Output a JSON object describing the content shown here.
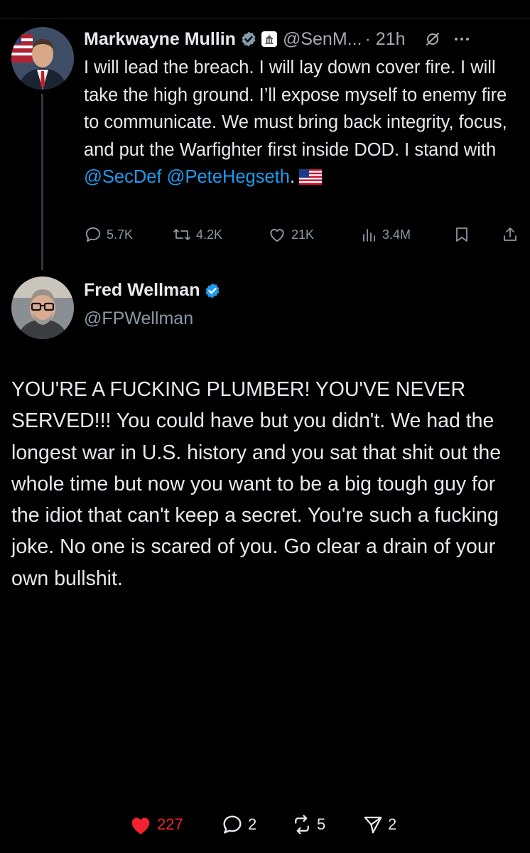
{
  "tweet1": {
    "author_name": "Markwayne Mullin",
    "handle": "@SenM...",
    "time": "· 21h",
    "body": {
      "text": "I will lead the breach. I will lay down cover fire. I will take the high ground. I’ll expose myself to enemy fire to communicate. We must bring back integrity, focus, and put the Warfighter first inside DOD. I stand with ",
      "mention1": "@SecDef",
      "mention2": "@PeteHegseth",
      "end": "."
    },
    "stats": {
      "replies": "5.7K",
      "reposts": "4.2K",
      "likes": "21K",
      "views": "3.4M"
    }
  },
  "tweet2": {
    "author_name": "Fred Wellman",
    "handle": "@FPWellman",
    "body": "YOU'RE A FUCKING PLUMBER! YOU'VE NEVER SERVED!!! You could have but you didn't.  We had the longest war in U.S. history and you sat that shit out the whole time but now you want to be a big tough guy for the idiot that can't keep a secret. You're such a fucking joke. No one is scared of you. Go clear a drain of your own bullshit."
  },
  "bottom_bar": {
    "likes": "227",
    "comments": "2",
    "reposts": "5",
    "shares": "2"
  },
  "colors": {
    "background": "#000000",
    "text": "#e7e9ea",
    "secondary": "#8b98a5",
    "link": "#1d9bf0",
    "like": "#f4212e"
  },
  "icons": [
    "gray-verified-icon",
    "government-badge-icon",
    "grok-icon",
    "more-icon",
    "reply-icon",
    "repost-icon",
    "like-icon",
    "views-icon",
    "bookmark-icon",
    "share-icon",
    "blue-verified-icon",
    "heart-filled-icon",
    "comment-icon",
    "repost-icon",
    "send-icon"
  ]
}
